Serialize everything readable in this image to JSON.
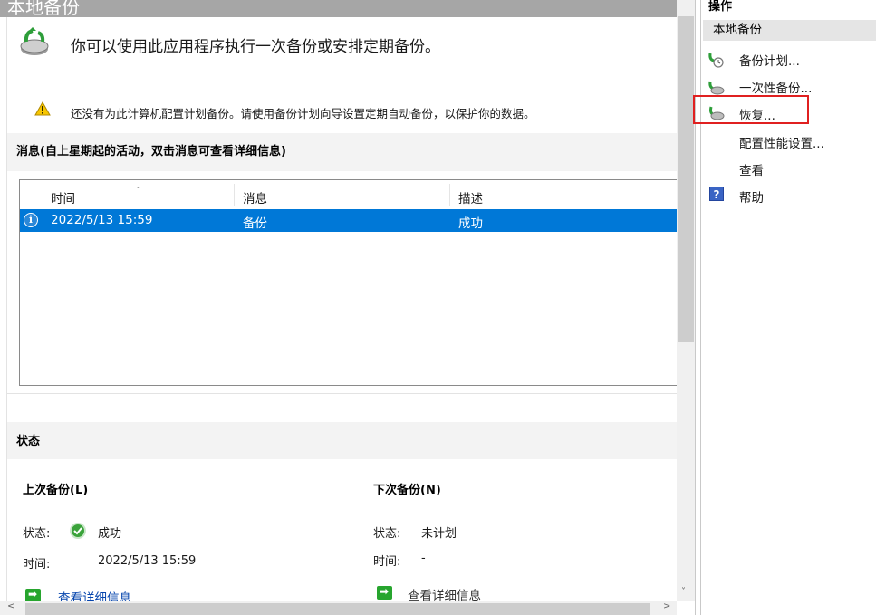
{
  "header": {
    "title": "本地备份"
  },
  "intro": {
    "text": "你可以使用此应用程序执行一次备份或安排定期备份。"
  },
  "warning": {
    "text": "还没有为此计算机配置计划备份。请使用备份计划向导设置定期自动备份，以保护你的数据。"
  },
  "messages": {
    "title": "消息(自上星期起的活动，双击消息可查看详细信息)",
    "columns": [
      "时间",
      "消息",
      "描述"
    ],
    "rows": [
      {
        "time": "2022/5/13 15:59",
        "message": "备份",
        "description": "成功"
      }
    ]
  },
  "status": {
    "title": "状态",
    "last": {
      "heading": "上次备份(L)",
      "status_label": "状态:",
      "status_value": "成功",
      "time_label": "时间:",
      "time_value": "2022/5/13 15:59",
      "link": "查看详细信息"
    },
    "next": {
      "heading": "下次备份(N)",
      "status_label": "状态:",
      "status_value": "未计划",
      "time_label": "时间:",
      "time_value": "-",
      "link": "查看详细信息"
    }
  },
  "actions": {
    "title": "操作",
    "section": "本地备份",
    "items": [
      "备份计划...",
      "一次性备份...",
      "恢复...",
      "配置性能设置...",
      "查看",
      "帮助"
    ]
  },
  "colors": {
    "selection": "#0078d7",
    "highlight_box": "#e02020",
    "link": "#0645ad"
  }
}
